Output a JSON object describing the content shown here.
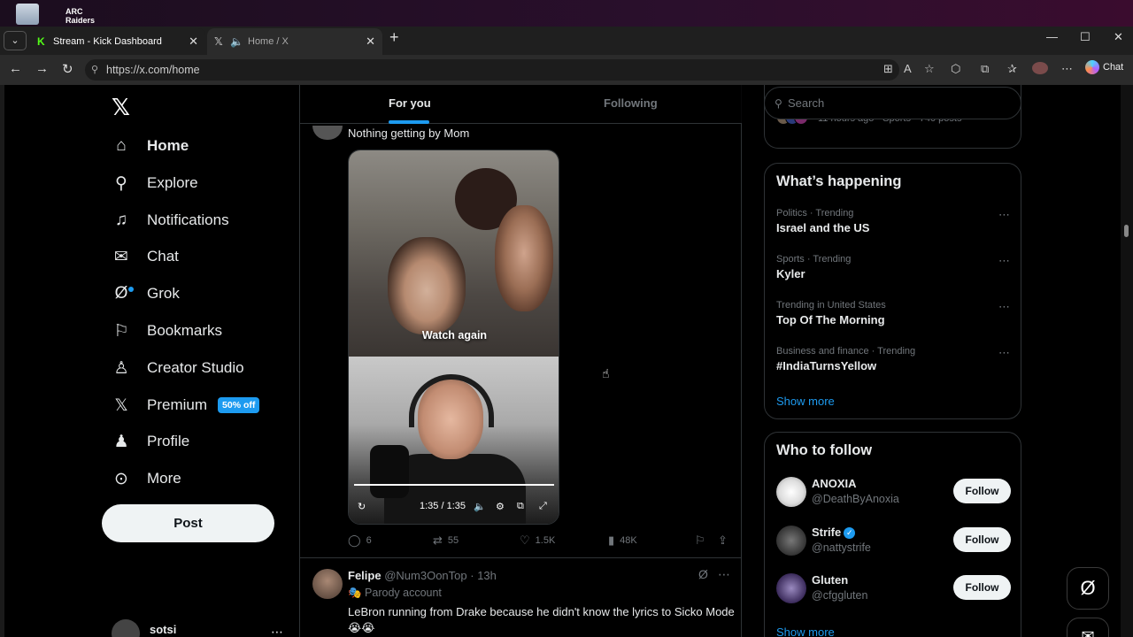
{
  "desktop": {
    "icons": [
      "recycle-bin-icon",
      "arc-raiders-icon"
    ],
    "arc_label": "ARC Raiders"
  },
  "browser": {
    "tabs": [
      {
        "label": "Stream - Kick Dashboard",
        "icon": "kick-icon",
        "accent": "#53fc18"
      },
      {
        "label": "Home / X",
        "icon": "x-icon"
      }
    ],
    "url": "https://x.com/home",
    "chat_label": "Chat"
  },
  "nav": {
    "items": [
      {
        "label": "Home",
        "icon": "home-icon"
      },
      {
        "label": "Explore",
        "icon": "search-icon"
      },
      {
        "label": "Notifications",
        "icon": "bell-icon"
      },
      {
        "label": "Chat",
        "icon": "mail-icon"
      },
      {
        "label": "Grok",
        "icon": "grok-icon"
      },
      {
        "label": "Bookmarks",
        "icon": "bookmark-icon"
      },
      {
        "label": "Creator Studio",
        "icon": "creator-studio-icon"
      },
      {
        "label": "Premium",
        "icon": "x-icon",
        "badge": "50% off"
      },
      {
        "label": "Profile",
        "icon": "person-icon"
      },
      {
        "label": "More",
        "icon": "more-circle-icon"
      }
    ],
    "post_label": "Post",
    "account_name": "sotsi"
  },
  "feed": {
    "tabs": [
      "For you",
      "Following"
    ],
    "tweet1": {
      "text": "Nothing getting by Mom",
      "media": {
        "overlay": "Watch again",
        "time": "1:35 / 1:35",
        "progress": 1.0
      },
      "replies": "6",
      "reposts": "55",
      "likes": "1.5K",
      "views": "48K"
    },
    "tweet2": {
      "name": "Felipe",
      "handle": "@Num3OonTop",
      "time": "13h",
      "label": "Parody account",
      "text": "LeBron running from Drake because he didn't know the lyrics to Sicko Mode 😭😭"
    }
  },
  "right": {
    "search_placeholder": "Search",
    "prev_meta": "11 hours ago · Sports · 740 posts",
    "happening": {
      "title": "What’s happening",
      "trends": [
        {
          "context": "Politics · Trending",
          "title": "Israel and the US"
        },
        {
          "context": "Sports · Trending",
          "title": "Kyler"
        },
        {
          "context": "Trending in United States",
          "title": "Top Of The Morning"
        },
        {
          "context": "Business and finance · Trending",
          "title": "#IndiaTurnsYellow"
        }
      ],
      "show_more": "Show more"
    },
    "who_to_follow": {
      "title": "Who to follow",
      "accounts": [
        {
          "name": "ANOXIA",
          "handle": "@DeathByAnoxia",
          "verified": false,
          "button": "Follow"
        },
        {
          "name": "Strife",
          "handle": "@nattystrife",
          "verified": true,
          "button": "Follow"
        },
        {
          "name": "Gluten",
          "handle": "@cfggluten",
          "verified": false,
          "button": "Follow"
        }
      ],
      "show_more": "Show more"
    }
  },
  "colors": {
    "accent": "#1d9bf0",
    "bg": "#000000",
    "border": "#2f3336",
    "muted": "#71767b"
  }
}
